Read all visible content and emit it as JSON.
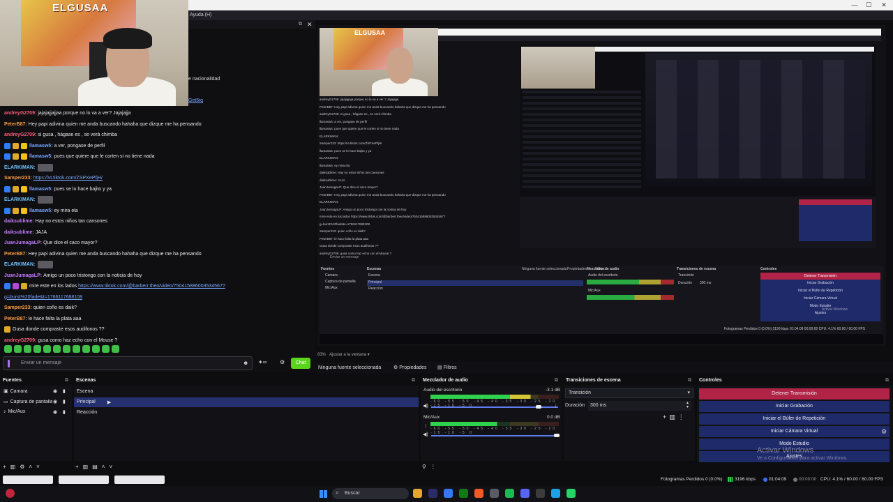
{
  "window": {
    "menu_partial": "Ayuda (H)",
    "controls": [
      "—",
      "☐",
      "✕"
    ]
  },
  "webcam": {
    "poster_text": "ELGUSAA"
  },
  "chat": {
    "partial_line_1": "e nacionalidad",
    "partial_line_2": "Get5tq",
    "messages": [
      {
        "user": "andreyG2709:",
        "color": "#ff5c7a",
        "text": "jajajajjajjaa porque no lo va a ver? Jajajajja",
        "badges": []
      },
      {
        "user": "PeterB87:",
        "color": "#ff9a3c",
        "text": "Hey papi adivina quien me anda buscando hahaha que dizque me ha pensando",
        "badges": []
      },
      {
        "user": "andreyG2709:",
        "color": "#ff5c7a",
        "text": "si gusa , hágase es , se verá chimba",
        "badges": []
      },
      {
        "user": "llamasw5:",
        "color": "#7aa7ff",
        "text": "a ver, pongase de perfil",
        "badges": [
          "#2f7cf6",
          "#e0a92c",
          "#f2c21b"
        ]
      },
      {
        "user": "llamasw5:",
        "color": "#7aa7ff",
        "text": "pues que quiere que le corten si no tiene nada",
        "badges": [
          "#2f7cf6",
          "#e0a92c",
          "#f2c21b"
        ]
      },
      {
        "user": "ELARKIMAN:",
        "color": "#6ec3ff",
        "text": "",
        "badges": [],
        "emote": true
      },
      {
        "user": "Samper233:",
        "color": "#ff9a3c",
        "link": "https://vt.tiktok.com/ZSPXePfjH/",
        "badges": []
      },
      {
        "user": "llamasw5:",
        "color": "#7aa7ff",
        "text": "pues se lo hace bajito y ya",
        "badges": [
          "#2f7cf6",
          "#e0a92c",
          "#f2c21b"
        ]
      },
      {
        "user": "ELARKIMAN:",
        "color": "#6ec3ff",
        "text": "",
        "badges": [],
        "emote": true
      },
      {
        "user": "llamasw5:",
        "color": "#7aa7ff",
        "text": "ey mira ela",
        "badges": [
          "#2f7cf6",
          "#e0a92c",
          "#f2c21b"
        ]
      },
      {
        "user": "daiksublime:",
        "color": "#c67cff",
        "text": "Hay no estos niños tan cansones",
        "badges": []
      },
      {
        "user": "daiksublime:",
        "color": "#c67cff",
        "text": "JAJA",
        "badges": []
      },
      {
        "user": "JuanJumagaLP:",
        "color": "#c67cff",
        "text": "Que dice el caco mayor?",
        "badges": []
      },
      {
        "user": "PeterB87:",
        "color": "#ff9a3c",
        "text": "Hey papi adivina quien me anda buscando hahaha que dizque me ha pensando",
        "badges": []
      },
      {
        "user": "ELARKIMAN:",
        "color": "#6ec3ff",
        "text": "",
        "badges": [],
        "emote": true
      },
      {
        "user": "JuanJumagaLP:",
        "color": "#c67cff",
        "text": "Amigo un poco tristongo con la noticia de hoy",
        "badges": []
      },
      {
        "user": "",
        "color": "#ff5c7a",
        "text": "mire este en los lados",
        "link": "https://www.tiktok.com/@barberr.theo/video/750415886003534567?",
        "badges": [
          "#2f7cf6",
          "#b14ad6",
          "#e0a92c"
        ]
      },
      {
        "user": "",
        "color": "#7aa7ff",
        "link": "g=burst%20fade&t=1766117688108",
        "badges": []
      },
      {
        "user": "Samper233:",
        "color": "#ff9a3c",
        "text": "quien coño es daik?",
        "badges": []
      },
      {
        "user": "PeterB87:",
        "color": "#ff9a3c",
        "text": "le hace falta la plata aaa",
        "badges": []
      },
      {
        "user": "",
        "color": "#ff5c7a",
        "text": "Gusa donde compraste esos audifonos ??",
        "badges": [
          "#e0a92c"
        ]
      },
      {
        "user": "andreyG2709:",
        "color": "#ff5c7a",
        "text": "gusa como haz echo con el Mouse ?",
        "badges": []
      }
    ],
    "input_placeholder": "Enviar un mensaje",
    "chat_button": "Chat"
  },
  "preview": {
    "poster_text": "ELGUSAA",
    "chat_lines": [
      "andreyG2709: jajajajjaja porque no lo va a ver ? Jajajajja",
      "PeterB87: Hey papi adivina quien me anda buscando hahaha que dizque me ha pensando",
      "andreyG2709: si gusa , hágase es , se verá chimba",
      "llamasw5: a ver, pongase de perfil",
      "llamasw5: pues que quiere que le corten si no tiene nada",
      "ELARKIMAN:",
      "Samper233: https://vt.tiktok.com/ZSPXePfjH/",
      "llamasw5: pues se lo hace bajito y ya",
      "ELARKIMAN:",
      "llamasw5: ey mira ela",
      "daiksublime: Hay no estos niños tan cansones",
      "daiksublime: JAJA",
      "JuanJumagaLP: Que dice el caco mayor?",
      "PeterB87: Hey papi adivina quien me anda buscando hahaha que dizque me ha pensando",
      "ELARKIMAN:",
      "JuanJumagaLP: Amigo un poco tristongo con la noticia de hoy",
      "mire este en los lados https://www.tiktok.com/@barberr.theo/video/750415886003534567?",
      "g=burst%20fade&t=1766117688108",
      "Samper233: quien coño es daik?",
      "PeterB87: le hace falta la plata aaa",
      "Gusa donde compraste esos audifonos ??",
      "andreyG2709: gusa como haz echo con el Mouse ?"
    ],
    "input_placeholder": "Enviar un mensaje",
    "no_source": "Ninguna fuente seleccionada",
    "props": "Propiedades",
    "filters": "Filtros",
    "docks": {
      "fuentes": "Fuentes",
      "escenas": "Escenas",
      "mezclador": "Mezclador de audio",
      "transiciones": "Transiciones de escena",
      "controles": "Controles",
      "sources": [
        "Camara",
        "Captura de pantalla",
        "Mic/Aux"
      ],
      "scenes": [
        "Escena",
        "Principal",
        "Reacción"
      ],
      "mixer": [
        "Audio del escritorio",
        "Mic/Aux"
      ],
      "transition": "Transición",
      "duration_label": "Duración",
      "duration": "300 ms",
      "controls": [
        "Detener Transmisión",
        "Iniciar Grabación",
        "Iniciar el Búfer de Repetición",
        "Iniciar Cámara Virtual",
        "Modo Estudio",
        "Ajustes"
      ],
      "watermark": "Activar Windows",
      "status": "Fotogramas Perdidos 0 (0.0%)   3196 kbps   01:04:08   00:00:00   CPU: 4.1%   60.00 / 60.00 FPS"
    }
  },
  "zoom": {
    "value": "83%",
    "fit": "Ajustar a la ventana"
  },
  "source_bar": {
    "none_selected": "Ninguna fuente seleccionada",
    "properties": "Propiedades",
    "filters": "Filtros"
  },
  "docks": {
    "sources_title": "Fuentes",
    "scenes_title": "Escenas",
    "mixer_title": "Mezclador de audio",
    "transitions_title": "Transiciones de escena",
    "controls_title": "Controles"
  },
  "sources": [
    {
      "name": "Camara",
      "icon": "camera-icon"
    },
    {
      "name": "Captura de pantalla",
      "icon": "monitor-icon"
    },
    {
      "name": "Mic/Aux",
      "icon": "microphone-icon"
    }
  ],
  "scenes": [
    {
      "name": "Escena",
      "selected": false
    },
    {
      "name": "Principal",
      "selected": true
    },
    {
      "name": "Reacción",
      "selected": false
    }
  ],
  "mixer": {
    "channels": [
      {
        "name": "Audio del escritorio",
        "db": "-3.1 dB",
        "level": 0.78,
        "volume": 0.85
      },
      {
        "name": "Mic/Aux",
        "db": "0.0 dB",
        "level": 0.52,
        "volume": 1.0
      }
    ],
    "scale": [
      "-60",
      "-55",
      "-50",
      "-45",
      "-40",
      "-35",
      "-30",
      "-25",
      "-20",
      "-15",
      "-10",
      "-5",
      "0"
    ]
  },
  "transitions": {
    "selected": "Transición",
    "duration_label": "Duración",
    "duration_value": "300 ms"
  },
  "controls": [
    {
      "label": "Detener Transmisión",
      "style": "red"
    },
    {
      "label": "Iniciar Grabación",
      "style": "blue"
    },
    {
      "label": "Iniciar el Búfer de Repetición",
      "style": "blue"
    },
    {
      "label": "Iniciar Cámara Virtual",
      "style": "blue"
    },
    {
      "label": "Modo Estudio",
      "style": "blue"
    },
    {
      "label": "Ajustes",
      "style": "blue"
    }
  ],
  "windows_watermark": {
    "title": "Activar Windows",
    "subtitle": "Ve a Configuración para activar Windows."
  },
  "status": {
    "frames_dropped": "Fotogramas Perdidos 0 (0.0%)",
    "kbps": "3196 kbps",
    "live_time": "01:04:09",
    "rec_time": "00:00:00",
    "cpu": "CPU: 4.1%",
    "fps": "60.00 / 60.00 FPS"
  },
  "taskbar": {
    "search_placeholder": "Buscar",
    "apps": [
      "file-explorer-icon",
      "premiere-icon",
      "store-icon",
      "xbox-icon",
      "brave-icon",
      "settings-icon",
      "spotify-icon",
      "discord-icon",
      "obs-icon",
      "edge-icon",
      "whatsapp-icon"
    ],
    "colors": [
      "#e5a72b",
      "#2c2c6a",
      "#3478f6",
      "#107c10",
      "#f05a24",
      "#5b5b66",
      "#1db954",
      "#5865f2",
      "#3b3b3b",
      "#1da1e6",
      "#25d366"
    ]
  }
}
